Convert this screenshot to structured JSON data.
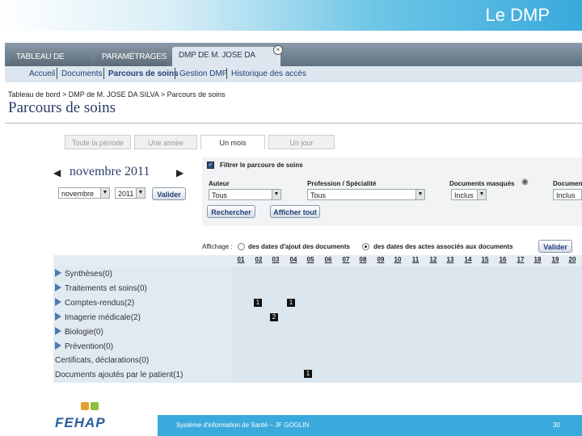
{
  "slide": {
    "title": "Le DMP",
    "footer": "Système d'information de Santé – JF GOGLIN",
    "page": "30",
    "logo": "FEHAP"
  },
  "tabs": [
    "TABLEAU DE BORD",
    "PARAMÉTRAGES",
    "DMP DE M. JOSE DA SILVA"
  ],
  "subnav": [
    "Accueil",
    "Documents",
    "Parcours de soins",
    "Gestion DMP",
    "Historique des accès"
  ],
  "breadcrumb": "Tableau de bord > DMP de M. JOSE DA SILVA > Parcours de soins",
  "page_title": "Parcours de soins",
  "period_tabs": [
    "Toute la période",
    "Une année",
    "Un mois",
    "Un jour"
  ],
  "calendar": {
    "month_label": "novembre 2011",
    "month_value": "novembre",
    "year_value": "2011",
    "validate": "Valider"
  },
  "filter": {
    "checkbox_label": "Filtrer le parcours de soins",
    "author_label": "Auteur",
    "author_value": "Tous",
    "profession_label": "Profession / Spécialité",
    "profession_value": "Tous",
    "masked_label": "Documents masqués",
    "masked_value": "Inclus",
    "docs_label": "Documen",
    "docs_value": "Inclus",
    "search": "Rechercher",
    "show_all": "Afficher tout"
  },
  "display": {
    "label": "Affichage :",
    "option1": "des dates d'ajout des documents",
    "option2": "des dates des actes associés aux documents",
    "validate": "Valider"
  },
  "days": [
    "01",
    "02",
    "03",
    "04",
    "05",
    "06",
    "07",
    "08",
    "09",
    "10",
    "11",
    "12",
    "13",
    "14",
    "15",
    "16",
    "17",
    "18",
    "19",
    "20"
  ],
  "rows": [
    {
      "label": "Synthèses(0)"
    },
    {
      "label": "Traitements et soins(0)"
    },
    {
      "label": "Comptes-rendus(2)"
    },
    {
      "label": "Imagerie médicale(2)"
    },
    {
      "label": "Biologie(0)"
    },
    {
      "label": "Prévention(0)"
    },
    {
      "label": "Certificats, déclarations(0)"
    },
    {
      "label": "Documents ajoutés par le patient(1)"
    }
  ],
  "counts": {
    "c1": "1",
    "c2": "1",
    "c3": "2",
    "c4": "1"
  }
}
